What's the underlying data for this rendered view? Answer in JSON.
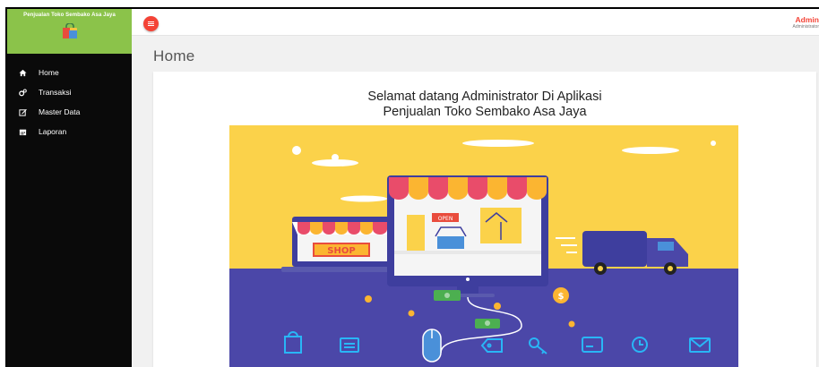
{
  "app": {
    "brand_title": "Penjualan Toko Sembako Asa Jaya"
  },
  "sidebar": {
    "items": [
      {
        "label": "Home",
        "icon": "home-icon"
      },
      {
        "label": "Transaksi",
        "icon": "cogs-icon"
      },
      {
        "label": "Master Data",
        "icon": "edit-icon"
      },
      {
        "label": "Laporan",
        "icon": "calendar-icon"
      }
    ]
  },
  "header": {
    "user_name": "Admin",
    "user_role": "Administrator"
  },
  "page": {
    "title": "Home",
    "welcome_line1": "Selamat datang Administrator Di Aplikasi",
    "welcome_line2": "Penjualan Toko Sembako Asa Jaya"
  },
  "illustration": {
    "shop_sign": "SHOP",
    "open_sign": "OPEN",
    "coin_label": "$"
  },
  "colors": {
    "brand_green": "#8bc34a",
    "accent_red": "#f44336",
    "sidebar_bg": "#0a0a0a",
    "illus_yellow": "#fbd24a",
    "illus_purple": "#4b47a8"
  }
}
